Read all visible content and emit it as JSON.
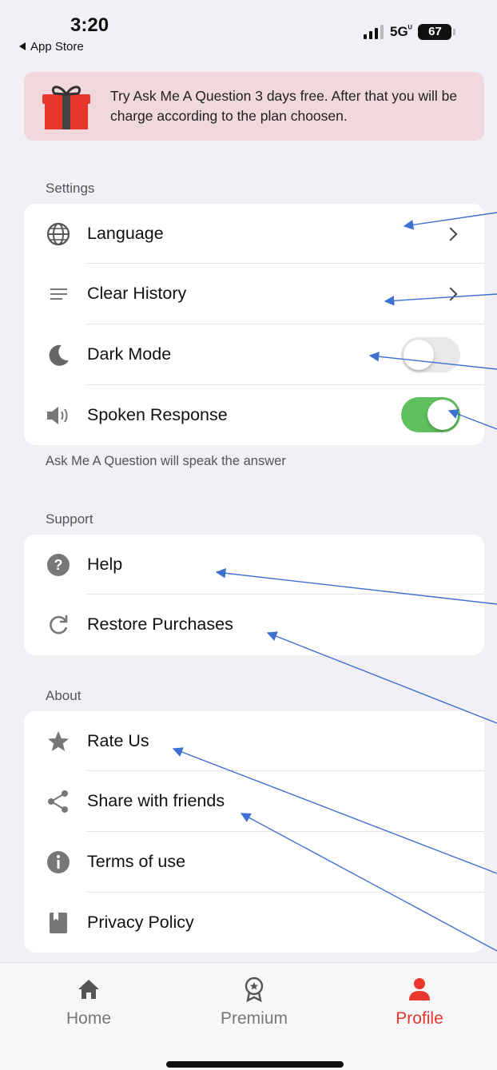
{
  "status_bar": {
    "time": "3:20",
    "back_label": "App Store",
    "network": "5G",
    "battery": "67"
  },
  "promo": {
    "icon": "gift-icon",
    "text": "Try Ask Me A Question 3 days free. After that you will be charge according to the plan choosen."
  },
  "settings": {
    "header": "Settings",
    "items": [
      {
        "label": "Language",
        "icon": "globe-icon"
      },
      {
        "label": "Clear History",
        "icon": "lines-icon"
      },
      {
        "label": "Dark Mode",
        "icon": "moon-icon",
        "toggle": false
      },
      {
        "label": "Spoken Response",
        "icon": "speaker-icon",
        "toggle": true
      }
    ],
    "footnote": "Ask Me A Question will speak the answer"
  },
  "support": {
    "header": "Support",
    "items": [
      {
        "label": "Help",
        "icon": "question-icon"
      },
      {
        "label": "Restore Purchases",
        "icon": "refresh-icon"
      }
    ]
  },
  "about": {
    "header": "About",
    "items": [
      {
        "label": "Rate Us",
        "icon": "star-icon"
      },
      {
        "label": "Share with friends",
        "icon": "share-icon"
      },
      {
        "label": "Terms of use",
        "icon": "info-icon"
      },
      {
        "label": "Privacy Policy",
        "icon": "book-icon"
      }
    ]
  },
  "tabs": [
    {
      "label": "Home",
      "icon": "home-icon",
      "active": false
    },
    {
      "label": "Premium",
      "icon": "award-icon",
      "active": false
    },
    {
      "label": "Profile",
      "icon": "person-icon",
      "active": true
    }
  ],
  "colors": {
    "accent": "#e8372d",
    "toggle_on": "#5fbf5f",
    "promo_bg": "#f0d8dc",
    "annotation_arrow": "#3f6fd1"
  }
}
